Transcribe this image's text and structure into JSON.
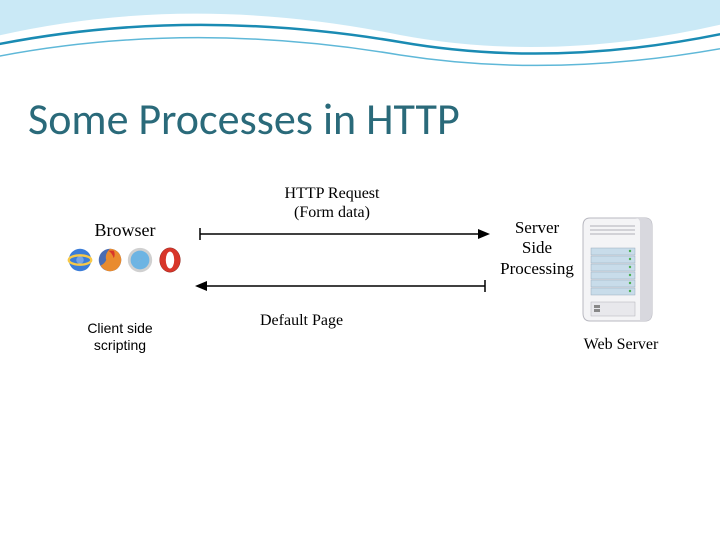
{
  "title": "Some Processes in HTTP",
  "diagram": {
    "browser_label": "Browser",
    "client_side_scripting": "Client side scripting",
    "http_request_line1": "HTTP Request",
    "http_request_line2": "(Form data)",
    "default_page": "Default Page",
    "server_side_line1": "Server",
    "server_side_line2": "Side",
    "server_side_line3": "Processing",
    "web_server": "Web Server"
  },
  "icons": {
    "ie": "internet-explorer-icon",
    "firefox": "firefox-icon",
    "safari": "safari-icon",
    "opera": "opera-icon"
  },
  "colors": {
    "title": "#2a6a7a",
    "wave_light": "#b3e0f2",
    "wave_dark": "#1a8bb3",
    "ie": "#3b7dd8",
    "firefox": "#e98b2e",
    "safari": "#6db4e3",
    "opera": "#d8362a"
  }
}
